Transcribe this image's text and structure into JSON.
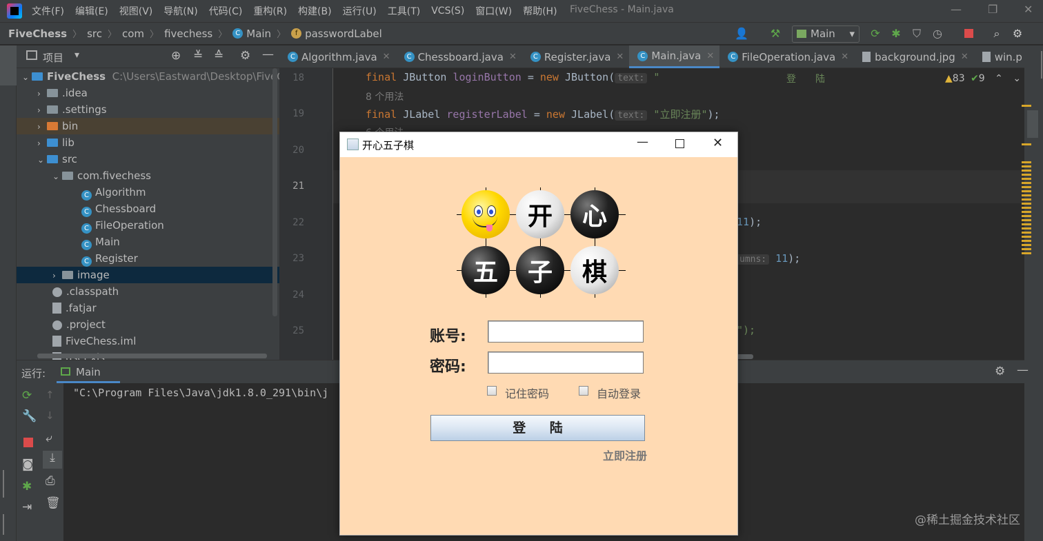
{
  "window": {
    "title": "FiveChess - Main.java"
  },
  "menu": [
    "文件(F)",
    "编辑(E)",
    "视图(V)",
    "导航(N)",
    "代码(C)",
    "重构(R)",
    "构建(B)",
    "运行(U)",
    "工具(T)",
    "VCS(S)",
    "窗口(W)",
    "帮助(H)"
  ],
  "breadcrumb": {
    "project": "FiveChess",
    "c1": "src",
    "c2": "com",
    "c3": "fivechess",
    "c4": "Main",
    "c5": "passwordLabel"
  },
  "run_config": "Main",
  "project_panel": {
    "title": "项目",
    "tree": {
      "root": "FiveChess",
      "root_path": "C:\\Users\\Eastward\\Desktop\\FiveChess",
      "idea": ".idea",
      "settings": ".settings",
      "bin": "bin",
      "lib": "lib",
      "src": "src",
      "pkg": "com.fivechess",
      "c1": "Algorithm",
      "c2": "Chessboard",
      "c3": "FileOperation",
      "c4": "Main",
      "c5": "Register",
      "image": "image",
      "classpath": ".classpath",
      "fatjar": ".fatjar",
      "project": ".project",
      "iml": "FiveChess.iml",
      "xls": "user.xls"
    }
  },
  "tabs": {
    "t1": "Algorithm.java",
    "t2": "Chessboard.java",
    "t3": "Register.java",
    "t4": "Main.java",
    "t5": "FileOperation.java",
    "t6": "background.jpg",
    "t7": "win.p"
  },
  "editor": {
    "lines": {
      "l18": "18",
      "l19": "19",
      "l20": "20",
      "l21": "21",
      "l22": "22",
      "l23": "23",
      "l24": "24",
      "l25": "25"
    },
    "usage1": "8 个用法",
    "usage2": "6 个用法",
    "code": {
      "kw_final": "final",
      "t_jbutton": "JButton",
      "f_login": "loginButton",
      "eq": "=",
      "kw_new": "new",
      "c_jbutton": "JButton(",
      "hint_text": "text:",
      "s_login_open": "\"",
      "s_login_text": "登　　陆",
      "t_jlabel": "JLabel",
      "f_register": "registerLabel",
      "c_jlabel": "JLabel(",
      "s_register": "\"立即注册\"",
      "end": ");",
      "n11a": "11",
      "frag23": "umns:",
      "n11b": "11",
      "frag25": "\");"
    },
    "warnings": "83",
    "checks": "9"
  },
  "run_panel": {
    "label": "运行:",
    "tab": "Main",
    "console_line": "\"C:\\Program Files\\Java\\jdk1.8.0_291\\bin\\j"
  },
  "dialog": {
    "title": "开心五子棋",
    "stones": {
      "s2": "开",
      "s3": "心",
      "s4": "五",
      "s5": "子",
      "s6": "棋"
    },
    "account_label": "账号:",
    "password_label": "密码:",
    "remember": "记住密码",
    "auto_login": "自动登录",
    "login": "登 陆",
    "register": "立即注册"
  },
  "watermark": "@稀土掘金技术社区"
}
